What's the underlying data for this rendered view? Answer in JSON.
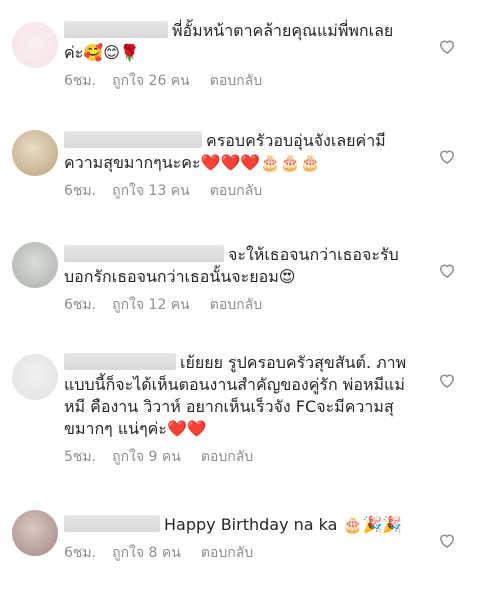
{
  "comments": [
    {
      "username_redacted": true,
      "text": "พี่อั้มหน้าตาคล้ายคุณแม่พี่พกเลยค่ะ🥰😊🌹",
      "time": "6ชม.",
      "likes": "ถูกใจ 26 คน",
      "reply": "ตอบกลับ",
      "like_icon": "heart-outline-icon"
    },
    {
      "username_redacted": true,
      "text": "ครอบครัวอบอุ่นจังเลยค่ามีความสุขมากๆนะคะ❤️❤️❤️🎂🎂🎂",
      "time": "6ชม.",
      "likes": "ถูกใจ 13 คน",
      "reply": "ตอบกลับ",
      "like_icon": "heart-outline-icon"
    },
    {
      "username_redacted": true,
      "username_fragment": "_",
      "text": "จะให้เธอจนกว่าเธอจะรับบอกรักเธอจนกว่าเธอนั้นจะยอม😍",
      "time": "6ชม.",
      "likes": "ถูกใจ 12 คน",
      "reply": "ตอบกลับ",
      "like_icon": "heart-outline-icon"
    },
    {
      "username_redacted": true,
      "username_fragment": "_",
      "text": "เย้ยยย รูปครอบครัวสุขสันต์. ภาพแบบนี้ก็จะได้เห็นตอนงานสำคัญของคู่รัก พ่อหมีแม่หมี คืองาน วิวาห์ อยากเห็นเร็วจัง FCจะมีความสุขมากๆ แน่ๆค่ะ❤️❤️",
      "time": "5ชม.",
      "likes": "ถูกใจ 9 คน",
      "reply": "ตอบกลับ",
      "like_icon": "heart-outline-icon"
    },
    {
      "username_redacted": true,
      "text": "Happy Birthday na ka 🎂🎉🎉",
      "time": "6ชม.",
      "likes": "ถูกใจ 8 คน",
      "reply": "ตอบกลับ",
      "like_icon": "heart-outline-icon"
    }
  ]
}
